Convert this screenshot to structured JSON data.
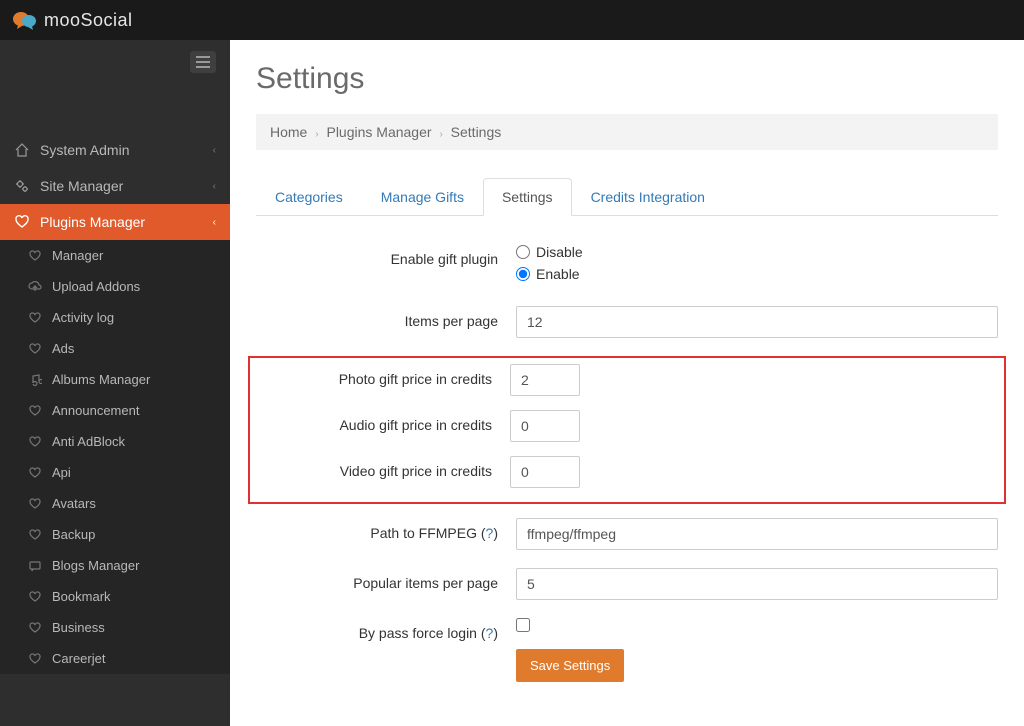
{
  "brand": "mooSocial",
  "page_title": "Settings",
  "breadcrumb": [
    "Home",
    "Plugins Manager",
    "Settings"
  ],
  "nav": {
    "system_admin": "System Admin",
    "site_manager": "Site Manager",
    "plugins_manager": "Plugins Manager",
    "sub": [
      "Manager",
      "Upload Addons",
      "Activity log",
      "Ads",
      "Albums Manager",
      "Announcement",
      "Anti AdBlock",
      "Api",
      "Avatars",
      "Backup",
      "Blogs Manager",
      "Bookmark",
      "Business",
      "Careerjet"
    ]
  },
  "tabs": {
    "categories": "Categories",
    "manage_gifts": "Manage Gifts",
    "settings": "Settings",
    "credits_integration": "Credits Integration"
  },
  "form": {
    "enable_label": "Enable gift plugin",
    "disable_option": "Disable",
    "enable_option": "Enable",
    "items_per_page_label": "Items per page",
    "items_per_page_value": "12",
    "photo_price_label": "Photo gift price in credits",
    "photo_price_value": "2",
    "audio_price_label": "Audio gift price in credits",
    "audio_price_value": "0",
    "video_price_label": "Video gift price in credits",
    "video_price_value": "0",
    "ffmpeg_label_prefix": "Path to FFMPEG (",
    "ffmpeg_label_suffix": ")",
    "ffmpeg_help": "?",
    "ffmpeg_value": "ffmpeg/ffmpeg",
    "popular_items_label": "Popular items per page",
    "popular_items_value": "5",
    "bypass_label_prefix": "By pass force login (",
    "bypass_label_suffix": ")",
    "bypass_help": "?",
    "save_button": "Save Settings"
  }
}
